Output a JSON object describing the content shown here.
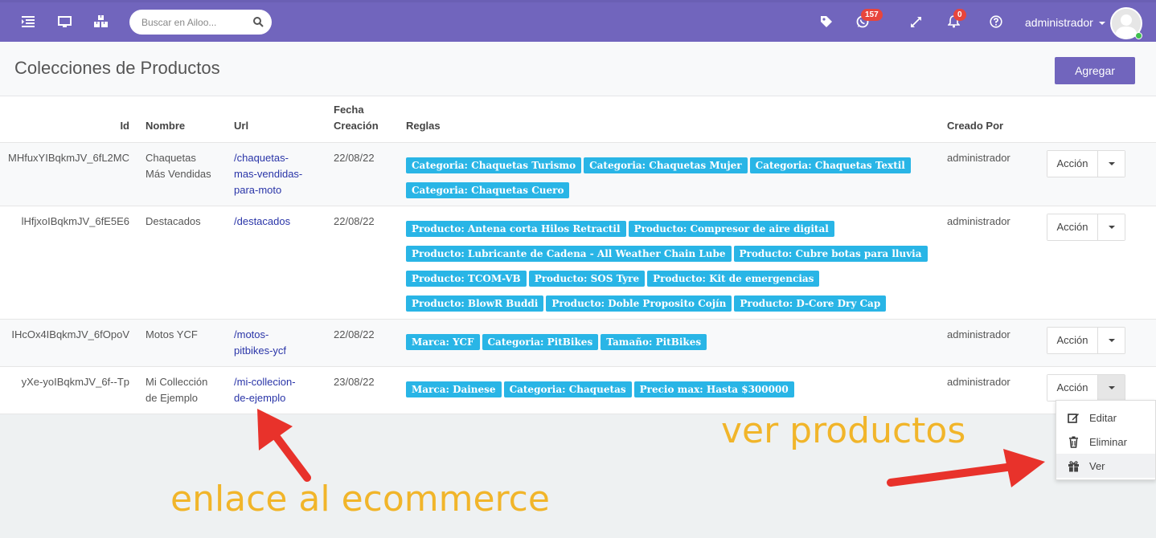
{
  "navbar": {
    "search_placeholder": "Buscar en Ailoo...",
    "whatsapp_badge": "157",
    "notifications_badge": "0",
    "user_label": "administrador"
  },
  "page": {
    "title": "Colecciones de Productos",
    "add_button": "Agregar"
  },
  "table": {
    "headers": {
      "id": "Id",
      "nombre": "Nombre",
      "url": "Url",
      "fecha": "Fecha Creación",
      "reglas": "Reglas",
      "creado": "Creado Por"
    },
    "action_label": "Acción",
    "rows": [
      {
        "id": "MHfuxYIBqkmJV_6fL2MC",
        "nombre": "Chaquetas Más Vendidas",
        "url": "/chaquetas-mas-vendidas-para-moto",
        "fecha": "22/08/22",
        "creado": "administrador",
        "reglas": [
          "Categoria: Chaquetas Turismo",
          "Categoria: Chaquetas Mujer",
          "Categoria: Chaquetas Textil",
          "Categoria: Chaquetas Cuero"
        ]
      },
      {
        "id": "lHfjxoIBqkmJV_6fE5E6",
        "nombre": "Destacados",
        "url": "/destacados",
        "fecha": "22/08/22",
        "creado": "administrador",
        "reglas": [
          "Producto: Antena corta Hilos Retractil",
          "Producto: Compresor de aire digital",
          "Producto: Lubricante de Cadena - All Weather Chain Lube",
          "Producto: Cubre botas para lluvia",
          "Producto: TCOM-VB",
          "Producto: SOS Tyre",
          "Producto: Kit de emergencias",
          "Producto: BlowR Buddi",
          "Producto: Doble Proposito Cojín",
          "Producto: D-Core Dry Cap"
        ]
      },
      {
        "id": "IHcOx4IBqkmJV_6fOpoV",
        "nombre": "Motos YCF",
        "url": "/motos-pitbikes-ycf",
        "fecha": "22/08/22",
        "creado": "administrador",
        "reglas": [
          "Marca: YCF",
          "Categoria: PitBikes",
          "Tamaño: PitBikes"
        ]
      },
      {
        "id": "yXe-yoIBqkmJV_6f--Tp",
        "nombre": "Mi Collección de Ejemplo",
        "url": "/mi-collecion-de-ejemplo",
        "fecha": "23/08/22",
        "creado": "administrador",
        "reglas": [
          "Marca: Dainese",
          "Categoria: Chaquetas",
          "Precio max: Hasta $300000"
        ]
      }
    ]
  },
  "dropdown": {
    "items": [
      "Editar",
      "Eliminar",
      "Ver"
    ]
  },
  "annotations": {
    "ver": "ver productos",
    "enlace": "enlace al ecommerce"
  },
  "colors": {
    "navbar": "#7165bd",
    "tag": "#29b5e6",
    "annotation": "#f1b52a",
    "arrow": "#e8322b"
  }
}
